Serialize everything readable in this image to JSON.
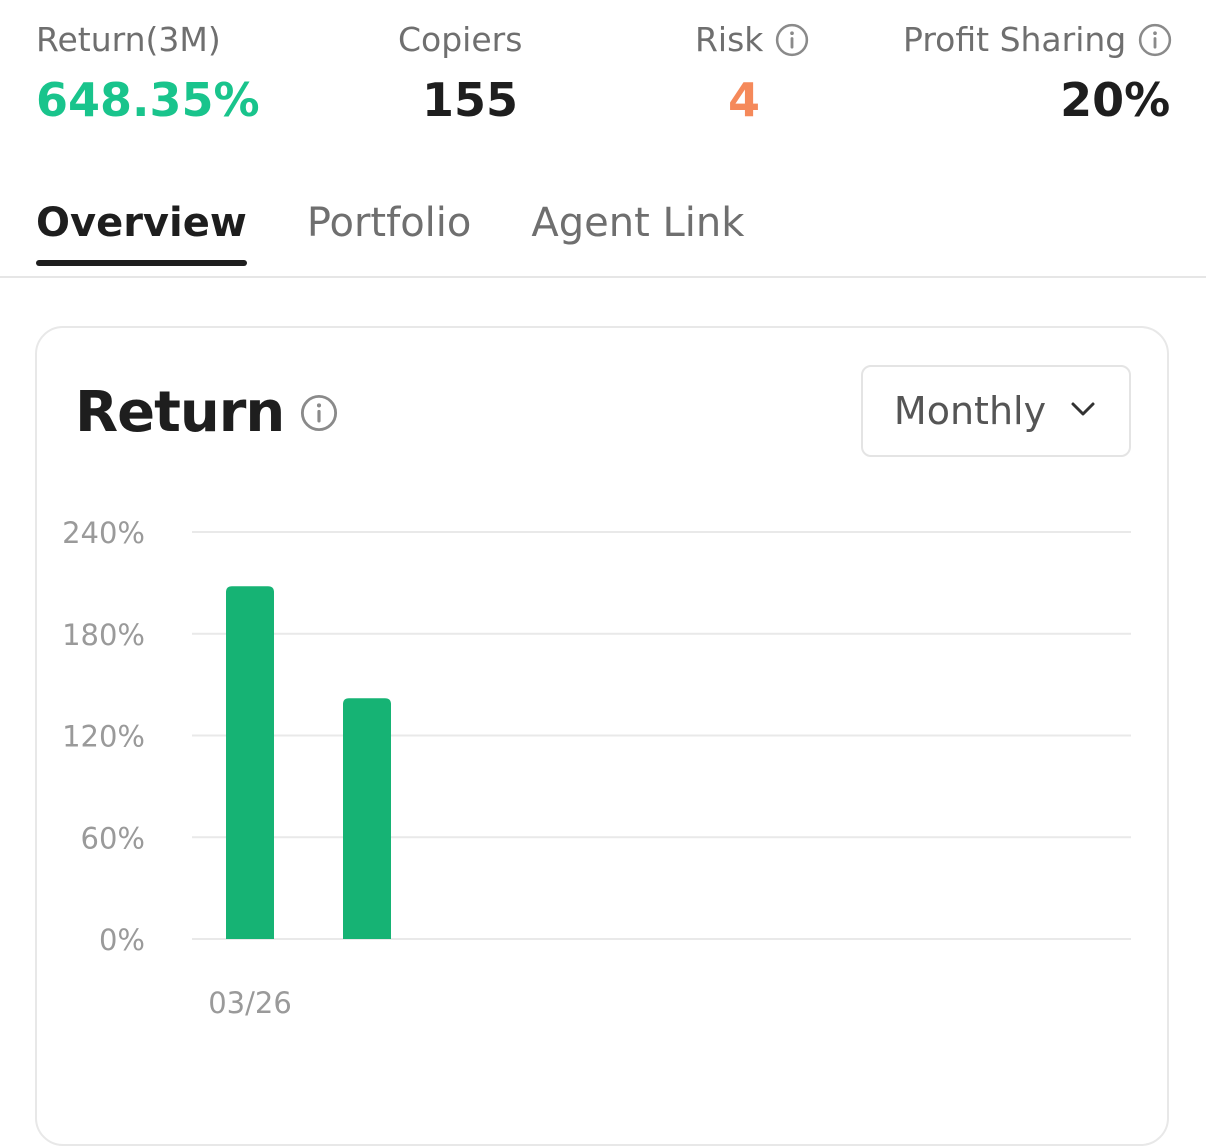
{
  "stats": [
    {
      "label": "Return(3M)",
      "value": "648.35%",
      "color": "#19c48c",
      "info": false
    },
    {
      "label": "Copiers",
      "value": "155",
      "color": "#1e1e1e",
      "info": false
    },
    {
      "label": "Risk",
      "value": "4",
      "color": "#f5895a",
      "info": true
    },
    {
      "label": "Profit Sharing",
      "value": "20%",
      "color": "#1e1e1e",
      "info": true
    }
  ],
  "tabs": [
    {
      "label": "Overview",
      "active": true
    },
    {
      "label": "Portfolio",
      "active": false
    },
    {
      "label": "Agent Link",
      "active": false
    }
  ],
  "card": {
    "title": "Return",
    "period_select": {
      "value": "Monthly"
    }
  },
  "colors": {
    "bar": "#16b374",
    "grid": "#e9e9e9",
    "tick_text": "#9a9a9a"
  },
  "chart_data": {
    "type": "bar",
    "categories": [
      "03/26",
      ""
    ],
    "values": [
      208,
      142
    ],
    "ylim": [
      0,
      240
    ],
    "yticks": [
      0,
      60,
      120,
      180,
      240
    ],
    "ytick_labels": [
      "0%",
      "60%",
      "120%",
      "180%",
      "240%"
    ],
    "xtick_labels": [
      "03/26"
    ],
    "grid": true,
    "title": "",
    "xlabel": "",
    "ylabel": ""
  }
}
